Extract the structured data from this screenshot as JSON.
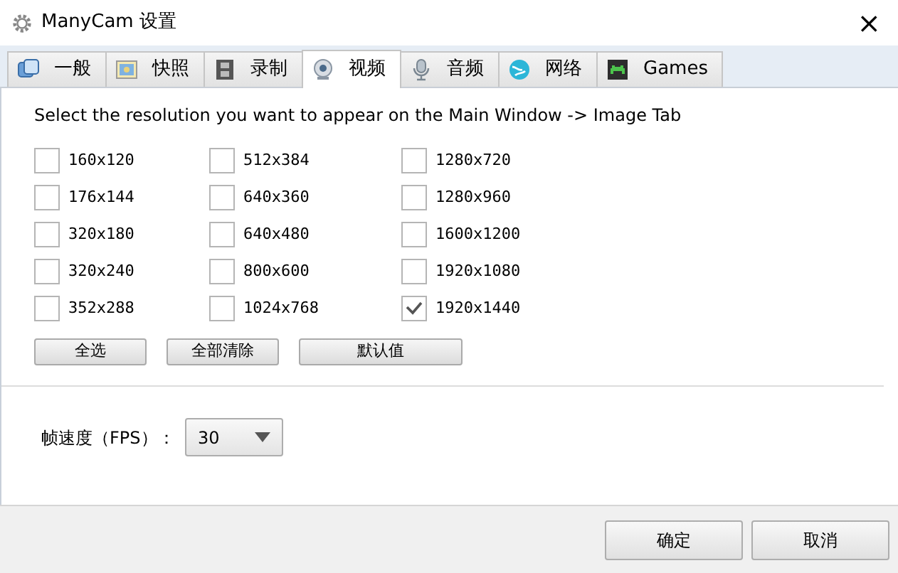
{
  "window": {
    "title": "ManyCam 设置",
    "close": "×"
  },
  "tabs": [
    {
      "label": "一般",
      "kind": "general",
      "selected": false
    },
    {
      "label": "快照",
      "kind": "snapshot",
      "selected": false
    },
    {
      "label": "录制",
      "kind": "film",
      "selected": false
    },
    {
      "label": "视频",
      "kind": "webcam",
      "selected": true
    },
    {
      "label": "音频",
      "kind": "mic",
      "selected": false
    },
    {
      "label": "网络",
      "kind": "globe",
      "selected": false
    },
    {
      "label": "Games",
      "kind": "game",
      "selected": false
    }
  ],
  "instruction": "Select the resolution you want to appear on the Main Window -> Image Tab",
  "resolutions": [
    {
      "label": "160x120",
      "checked": false
    },
    {
      "label": "176x144",
      "checked": false
    },
    {
      "label": "320x180",
      "checked": false
    },
    {
      "label": "320x240",
      "checked": false
    },
    {
      "label": "352x288",
      "checked": false
    },
    {
      "label": "512x384",
      "checked": false
    },
    {
      "label": "640x360",
      "checked": false
    },
    {
      "label": "640x480",
      "checked": false
    },
    {
      "label": "800x600",
      "checked": false
    },
    {
      "label": "1024x768",
      "checked": false
    },
    {
      "label": "1280x720",
      "checked": false
    },
    {
      "label": "1280x960",
      "checked": false
    },
    {
      "label": "1600x1200",
      "checked": false
    },
    {
      "label": "1920x1080",
      "checked": false
    },
    {
      "label": "1920x1440",
      "checked": true
    }
  ],
  "selection_buttons": [
    "全选",
    "全部清除",
    "默认值"
  ],
  "fps": {
    "label": "帧速度（FPS）：",
    "value": "30"
  },
  "footer_buttons": [
    "确定",
    "取消"
  ]
}
